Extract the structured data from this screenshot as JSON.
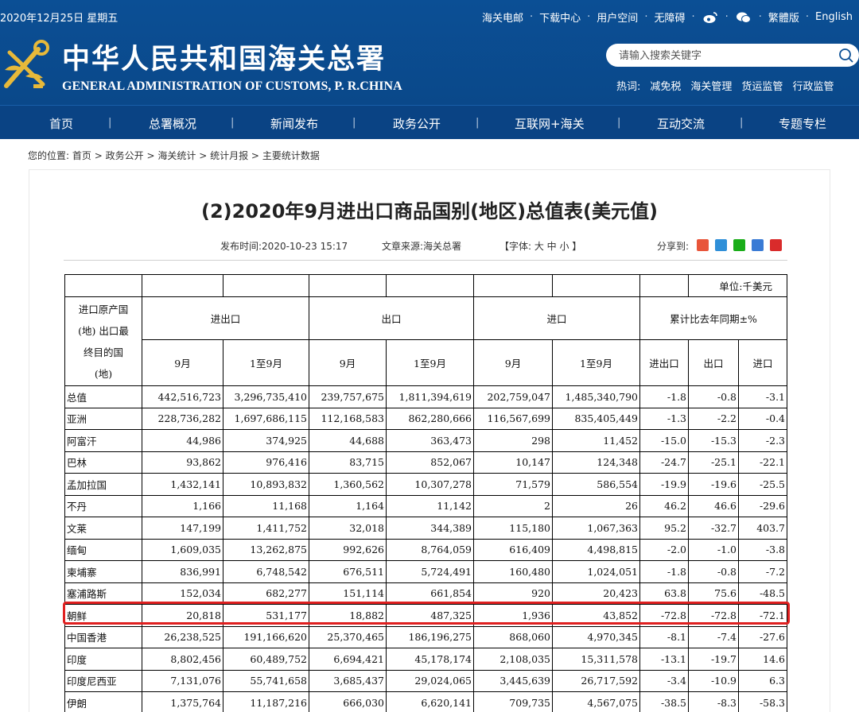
{
  "topbar": {
    "date": "2020年12月25日 星期五",
    "links": [
      "海关电邮",
      "下载中心",
      "用户空间",
      "无障碍",
      "繁體版",
      "English"
    ],
    "icons": [
      "weibo-icon",
      "wechat-icon"
    ]
  },
  "brand": {
    "name_cn": "中华人民共和国海关总署",
    "name_en": "GENERAL ADMINISTRATION OF CUSTOMS, P. R.CHINA"
  },
  "search": {
    "placeholder": "请输入搜索关键字"
  },
  "hotwords": {
    "label": "热词:",
    "items": [
      "减免税",
      "海关管理",
      "货运监管",
      "行政监管"
    ]
  },
  "nav": [
    "首页",
    "总署概况",
    "新闻发布",
    "政务公开",
    "互联网+海关",
    "互动交流",
    "专题专栏"
  ],
  "breadcrumb": {
    "prefix": "您的位置:",
    "items": [
      "首页",
      "政务公开",
      "海关统计",
      "统计月报",
      "主要统计数据"
    ],
    "sep": ">"
  },
  "article": {
    "title": "(2)2020年9月进出口商品国别(地区)总值表(美元值)",
    "published": "发布时间:2020-10-23 15:17",
    "source": "文章来源:海关总署",
    "font_label": "【字体: 大 中 小 】",
    "share_label": "分享到:",
    "share_colors": [
      "#e8553a",
      "#2f8fd8",
      "#1aad19",
      "#3a7bd5",
      "#d92b2b"
    ]
  },
  "table": {
    "unit": "单位:千美元",
    "col_name_header": [
      "进口原产国",
      "(地) 出口最",
      "终目的国",
      "(地)"
    ],
    "groups": [
      "进出口",
      "出口",
      "进口",
      "累计比去年同期±%"
    ],
    "subheaders": [
      "9月",
      "1至9月",
      "9月",
      "1至9月",
      "9月",
      "1至9月",
      "进出口",
      "出口",
      "进口"
    ],
    "rows": [
      [
        "总值",
        "442,516,723",
        "3,296,735,410",
        "239,757,675",
        "1,811,394,619",
        "202,759,047",
        "1,485,340,790",
        "-1.8",
        "-0.8",
        "-3.1"
      ],
      [
        "亚洲",
        "228,736,282",
        "1,697,686,115",
        "112,168,583",
        "862,280,666",
        "116,567,699",
        "835,405,449",
        "-1.3",
        "-2.2",
        "-0.4"
      ],
      [
        "阿富汗",
        "44,986",
        "374,925",
        "44,688",
        "363,473",
        "298",
        "11,452",
        "-15.0",
        "-15.3",
        "-2.3"
      ],
      [
        "巴林",
        "93,862",
        "976,416",
        "83,715",
        "852,067",
        "10,147",
        "124,348",
        "-24.7",
        "-25.1",
        "-22.1"
      ],
      [
        "孟加拉国",
        "1,432,141",
        "10,893,832",
        "1,360,562",
        "10,307,278",
        "71,579",
        "586,554",
        "-19.9",
        "-19.6",
        "-25.5"
      ],
      [
        "不丹",
        "1,166",
        "11,168",
        "1,164",
        "11,142",
        "2",
        "26",
        "46.2",
        "46.6",
        "-29.6"
      ],
      [
        "文莱",
        "147,199",
        "1,411,752",
        "32,018",
        "344,389",
        "115,180",
        "1,067,363",
        "95.2",
        "-32.7",
        "403.7"
      ],
      [
        "缅甸",
        "1,609,035",
        "13,262,875",
        "992,626",
        "8,764,059",
        "616,409",
        "4,498,815",
        "-2.0",
        "-1.0",
        "-3.8"
      ],
      [
        "柬埔寨",
        "836,991",
        "6,748,542",
        "676,511",
        "5,724,491",
        "160,480",
        "1,024,051",
        "-1.8",
        "-0.8",
        "-7.2"
      ],
      [
        "塞浦路斯",
        "152,034",
        "682,277",
        "151,114",
        "661,854",
        "920",
        "20,423",
        "63.8",
        "75.6",
        "-48.5"
      ],
      [
        "朝鲜",
        "20,818",
        "531,177",
        "18,882",
        "487,325",
        "1,936",
        "43,852",
        "-72.8",
        "-72.8",
        "-72.1"
      ],
      [
        "中国香港",
        "26,238,525",
        "191,166,620",
        "25,370,465",
        "186,196,275",
        "868,060",
        "4,970,345",
        "-8.1",
        "-7.4",
        "-27.6"
      ],
      [
        "印度",
        "8,802,456",
        "60,489,752",
        "6,694,421",
        "45,178,174",
        "2,108,035",
        "15,311,578",
        "-13.1",
        "-19.7",
        "14.6"
      ],
      [
        "印度尼西亚",
        "7,131,076",
        "55,741,658",
        "3,685,437",
        "29,024,065",
        "3,445,639",
        "26,717,592",
        "-3.4",
        "-10.9",
        "6.3"
      ],
      [
        "伊朗",
        "1,375,764",
        "11,187,216",
        "666,030",
        "6,620,141",
        "709,735",
        "4,567,075",
        "-38.5",
        "-8.3",
        "-58.3"
      ]
    ],
    "highlighted_row": "朝鲜"
  }
}
